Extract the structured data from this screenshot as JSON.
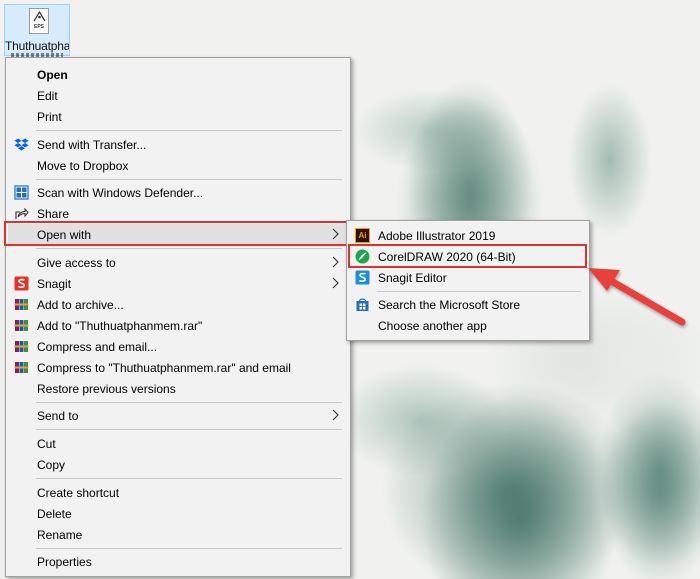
{
  "desktop": {
    "file_icon": {
      "name": "Thuthuatpha",
      "type_label": "EPS"
    }
  },
  "context_menu": {
    "items": [
      {
        "label": "Open"
      },
      {
        "label": "Edit"
      },
      {
        "label": "Print"
      },
      {
        "label": "Send with Transfer..."
      },
      {
        "label": "Move to Dropbox"
      },
      {
        "label": "Scan with Windows Defender..."
      },
      {
        "label": "Share"
      },
      {
        "label": "Open with"
      },
      {
        "label": "Give access to"
      },
      {
        "label": "Snagit"
      },
      {
        "label": "Add to archive..."
      },
      {
        "label": "Add to \"Thuthuatphanmem.rar\""
      },
      {
        "label": "Compress and email..."
      },
      {
        "label": "Compress to \"Thuthuatphanmem.rar\" and email"
      },
      {
        "label": "Restore previous versions"
      },
      {
        "label": "Send to"
      },
      {
        "label": "Cut"
      },
      {
        "label": "Copy"
      },
      {
        "label": "Create shortcut"
      },
      {
        "label": "Delete"
      },
      {
        "label": "Rename"
      },
      {
        "label": "Properties"
      }
    ]
  },
  "open_with_submenu": {
    "items": [
      {
        "label": "Adobe Illustrator 2019",
        "icon_text": "Ai"
      },
      {
        "label": "CorelDRAW 2020 (64-Bit)"
      },
      {
        "label": "Snagit Editor"
      },
      {
        "label": "Search the Microsoft Store"
      },
      {
        "label": "Choose another app"
      }
    ]
  },
  "colors": {
    "highlight_box": "#e0322d",
    "arrow": "#e8413c",
    "menu_background": "#f2f2f2"
  }
}
